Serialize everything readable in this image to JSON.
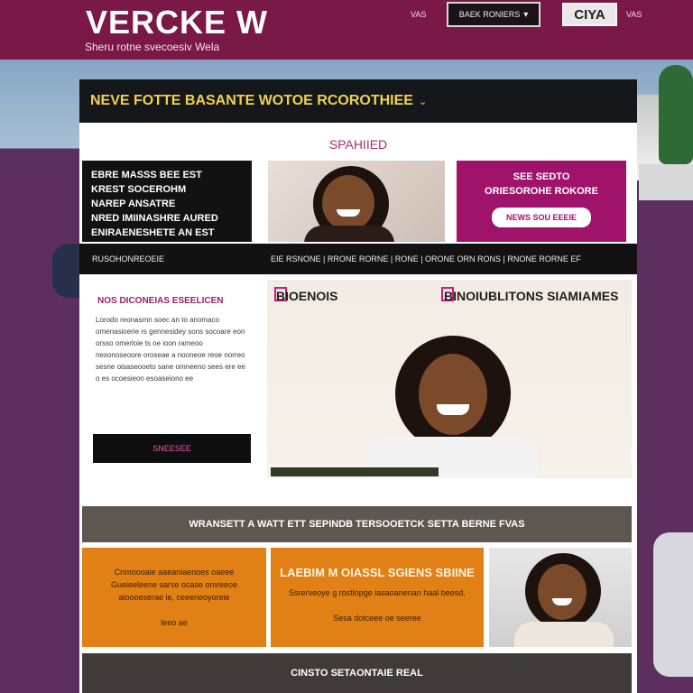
{
  "header": {
    "title": "VERCKE W",
    "tagline": "Sheru rotne svecoesiv Wela",
    "nav_link_left": "VAS",
    "nav_link_right": "VAS",
    "nav_select_label": "BAEK RONIERS",
    "nav_cta_label": "CIYA"
  },
  "banner": {
    "text": "NEVE FOTTE BASANTE WOTOE RCOROTHIEE"
  },
  "section": {
    "label": "SPAHIIED"
  },
  "featured": {
    "dark_card_lines": [
      "EBRE MASSS BEE EST",
      "KREST SOCEROHM",
      "NAREP ANSATRE",
      "NRED IMIINASHRE AURED",
      "ENIRAENESHETE AN EST"
    ],
    "magenta_card_lines": [
      "SEE SEDTO",
      "ORIESOROHE ROKORE"
    ],
    "magenta_button_label": "NEWS SOU EEEIE"
  },
  "strip": {
    "left_text": "RUSOHONREOEIE",
    "right_text": "EIE RSNONE | RRONE RORNE | RONE | ORONE ORN RONS | RNONE RORNE EF"
  },
  "sidebar": {
    "title": "NOS DICONEIAS ESEELICEN",
    "body": "Lorodo reonasmn soec an to anomaco omenasioerie rs gennesidey sons socoare eon orsso omerloie ts oe ioon rameoo nesonoseoore oroseae a nooneoe reoe norreo sesne oisaseooeto sane omneeno sees ere ee o es ocoesieon esoaseiono ee",
    "button_label": "SNEESEE"
  },
  "feature": {
    "label_left": "BIOENOIS",
    "label_right": "BINOIUBLITONS SIAMIAMES"
  },
  "bands": {
    "gray_text": "WRANSETT A WATT ETT SEPINDB TERSOOETCK SETTA BERNE FVAS",
    "footer_text": "CINSTO SETAONTAIE REAL"
  },
  "cards": [
    {
      "title": "",
      "body": "Cnmoooaie aaeaniaenoes oaeee Gueieeleene sarse ocase omreeoe aioooeserae ie, ceeeneoyoreie",
      "foot": "leeo ae"
    },
    {
      "title": "LAEBIM M OIASSL SGIENS SBIINE",
      "body": "Ssrerveoye g rostlopge iasaoanenan haal beesd.",
      "foot": "Sesa dotceee oe seeree"
    }
  ],
  "colors": {
    "topbar": "#7a1848",
    "banner": "#15171a",
    "accent_yellow": "#f0d24f",
    "accent_magenta": "#a0136b",
    "orange": "#e08015"
  }
}
